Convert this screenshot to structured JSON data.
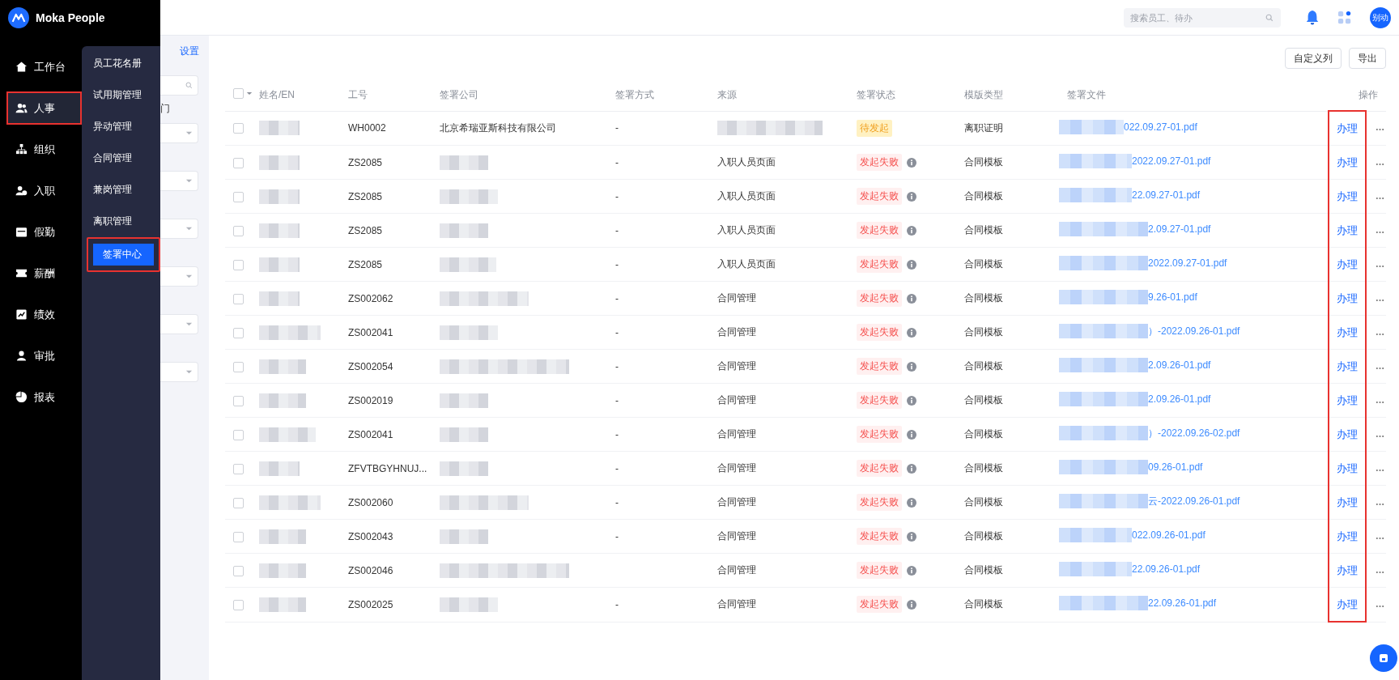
{
  "brand": {
    "name": "Moka People"
  },
  "nav": [
    {
      "label": "工作台",
      "selected": false,
      "annotated": false
    },
    {
      "label": "人事",
      "selected": true,
      "annotated": true
    },
    {
      "label": "组织",
      "selected": false,
      "annotated": false
    },
    {
      "label": "入职",
      "selected": false,
      "annotated": false
    },
    {
      "label": "假勤",
      "selected": false,
      "annotated": false
    },
    {
      "label": "薪酬",
      "selected": false,
      "annotated": false
    },
    {
      "label": "绩效",
      "selected": false,
      "annotated": false
    },
    {
      "label": "审批",
      "selected": false,
      "annotated": false
    },
    {
      "label": "报表",
      "selected": false,
      "annotated": false
    }
  ],
  "submenu": [
    {
      "label": "员工花名册",
      "selected": false,
      "annotated": false
    },
    {
      "label": "试用期管理",
      "selected": false,
      "annotated": false
    },
    {
      "label": "异动管理",
      "selected": false,
      "annotated": false
    },
    {
      "label": "合同管理",
      "selected": false,
      "annotated": false
    },
    {
      "label": "兼岗管理",
      "selected": false,
      "annotated": false
    },
    {
      "label": "离职管理",
      "selected": false,
      "annotated": false
    },
    {
      "label": "签署中心",
      "selected": true,
      "annotated": true
    }
  ],
  "header": {
    "search": {
      "placeholder": "搜索员工、待办"
    },
    "avatar": "别动"
  },
  "filters": {
    "settings_link": "设置",
    "fields": [
      {
        "kind": "search"
      },
      {
        "kind": "label",
        "text": "门"
      },
      {
        "kind": "select"
      },
      {
        "kind": "select"
      },
      {
        "kind": "select"
      },
      {
        "kind": "select"
      },
      {
        "kind": "select"
      },
      {
        "kind": "select"
      }
    ]
  },
  "toolbar": [
    "自定义列",
    "导出"
  ],
  "table": {
    "select_all": {
      "checked": false
    },
    "columns": [
      "姓名/EN",
      "工号",
      "签署公司",
      "签署方式",
      "来源",
      "签署状态",
      "模版类型",
      "签署文件",
      "操作"
    ],
    "actions_annotated": true,
    "rows": [
      {
        "checked": false,
        "id": "WH0002",
        "company": "北京希瑞亚斯科技有限公司",
        "method": "-",
        "status": {
          "kind": "pending",
          "text": "待发起"
        },
        "template": "离职证明",
        "file": "022.09.27-01.pdf",
        "action": "办理"
      },
      {
        "checked": false,
        "id": "ZS2085",
        "method": "-",
        "source": "入职人员页面",
        "status": {
          "kind": "failed",
          "text": "发起失败"
        },
        "template": "合同模板",
        "file": "2022.09.27-01.pdf",
        "action": "办理"
      },
      {
        "checked": false,
        "id": "ZS2085",
        "method": "-",
        "source": "入职人员页面",
        "status": {
          "kind": "failed",
          "text": "发起失败"
        },
        "template": "合同模板",
        "file": "22.09.27-01.pdf",
        "action": "办理"
      },
      {
        "checked": false,
        "id": "ZS2085",
        "method": "-",
        "source": "入职人员页面",
        "status": {
          "kind": "failed",
          "text": "发起失败"
        },
        "template": "合同模板",
        "file": "2.09.27-01.pdf",
        "action": "办理"
      },
      {
        "checked": false,
        "id": "ZS2085",
        "method": "-",
        "source": "入职人员页面",
        "status": {
          "kind": "failed",
          "text": "发起失败"
        },
        "template": "合同模板",
        "file": "2022.09.27-01.pdf",
        "action": "办理"
      },
      {
        "checked": false,
        "id": "ZS002062",
        "method": "-",
        "source": "合同管理",
        "status": {
          "kind": "failed",
          "text": "发起失败"
        },
        "template": "合同模板",
        "file": "9.26-01.pdf",
        "action": "办理"
      },
      {
        "checked": false,
        "id": "ZS002041",
        "method": "-",
        "source": "合同管理",
        "status": {
          "kind": "failed",
          "text": "发起失败"
        },
        "template": "合同模板",
        "file": "）-2022.09.26-01.pdf",
        "action": "办理"
      },
      {
        "checked": false,
        "id": "ZS002054",
        "method": "-",
        "source": "合同管理",
        "status": {
          "kind": "failed",
          "text": "发起失败"
        },
        "template": "合同模板",
        "file": "2.09.26-01.pdf",
        "action": "办理"
      },
      {
        "checked": false,
        "id": "ZS002019",
        "method": "-",
        "source": "合同管理",
        "status": {
          "kind": "failed",
          "text": "发起失败"
        },
        "template": "合同模板",
        "file": "2.09.26-01.pdf",
        "action": "办理"
      },
      {
        "checked": false,
        "id": "ZS002041",
        "method": "-",
        "source": "合同管理",
        "status": {
          "kind": "failed",
          "text": "发起失败"
        },
        "template": "合同模板",
        "file": "）-2022.09.26-02.pdf",
        "action": "办理"
      },
      {
        "checked": false,
        "id": "ZFVTBGYHNUJ...",
        "method": "-",
        "source": "合同管理",
        "status": {
          "kind": "failed",
          "text": "发起失败"
        },
        "template": "合同模板",
        "file": "09.26-01.pdf",
        "action": "办理"
      },
      {
        "checked": false,
        "id": "ZS002060",
        "method": "-",
        "source": "合同管理",
        "status": {
          "kind": "failed",
          "text": "发起失败"
        },
        "template": "合同模板",
        "file": "云-2022.09.26-01.pdf",
        "action": "办理"
      },
      {
        "checked": false,
        "id": "ZS002043",
        "method": "-",
        "source": "合同管理",
        "status": {
          "kind": "failed",
          "text": "发起失败"
        },
        "template": "合同模板",
        "file": "022.09.26-01.pdf",
        "action": "办理"
      },
      {
        "checked": false,
        "id": "ZS002046",
        "source": "合同管理",
        "status": {
          "kind": "failed",
          "text": "发起失败"
        },
        "template": "合同模板",
        "file": "22.09.26-01.pdf",
        "action": "办理"
      },
      {
        "checked": false,
        "id": "ZS002025",
        "method": "-",
        "source": "合同管理",
        "status": {
          "kind": "failed",
          "text": "发起失败"
        },
        "template": "合同模板",
        "file": "22.09.26-01.pdf",
        "action": "办理"
      }
    ]
  }
}
